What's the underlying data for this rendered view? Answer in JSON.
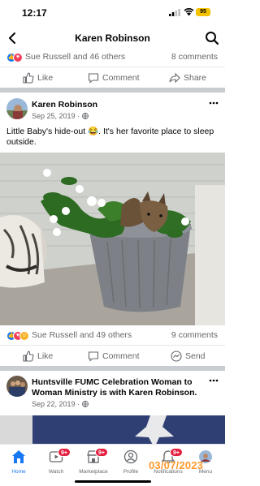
{
  "status_bar": {
    "time": "12:17",
    "battery": "95"
  },
  "header": {
    "title": "Karen Robinson"
  },
  "prev_post": {
    "reactions_text": "Sue Russell and 46 others",
    "comments": "8 comments",
    "actions": {
      "like": "Like",
      "comment": "Comment",
      "share": "Share"
    }
  },
  "post": {
    "author": "Karen Robinson",
    "date": "Sep 25, 2019 ·",
    "text": "Little Baby's hide-out 😂.  It's her favorite place to sleep outside.",
    "reactions_text": "Sue Russell and 49 others",
    "comments": "9 comments",
    "actions": {
      "like": "Like",
      "comment": "Comment",
      "send": "Send"
    }
  },
  "next_post": {
    "author": "Huntsville FUMC Celebration Woman to Woman Ministry is with Karen Robinson.",
    "date": "Sep 22, 2019 ·"
  },
  "tabbar": {
    "tabs": [
      {
        "label": "Home",
        "badge": ""
      },
      {
        "label": "Watch",
        "badge": "9+"
      },
      {
        "label": "Marketplace",
        "badge": "9+"
      },
      {
        "label": "Profile",
        "badge": ""
      },
      {
        "label": "Notifications",
        "badge": "9+"
      },
      {
        "label": "Menu",
        "badge": ""
      }
    ]
  },
  "watermark": "03/07/2023",
  "colors": {
    "accent": "#1877f2",
    "badge": "#e41e3f",
    "divider": "#c9ccd1"
  }
}
